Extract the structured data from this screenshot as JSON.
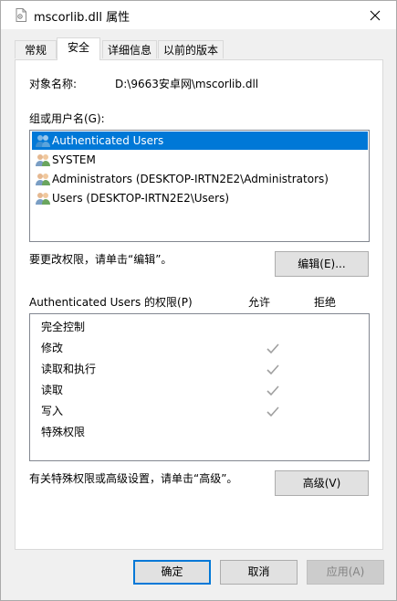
{
  "window": {
    "title": "mscorlib.dll 属性",
    "close_glyph": "✕"
  },
  "tabs": [
    {
      "label": "常规",
      "active": false
    },
    {
      "label": "安全",
      "active": true
    },
    {
      "label": "详细信息",
      "active": false
    },
    {
      "label": "以前的版本",
      "active": false
    }
  ],
  "security": {
    "object_name_label": "对象名称:",
    "object_name_value": "D:\\9663安卓网\\mscorlib.dll",
    "groups_label": "组或用户名(G):",
    "users": [
      {
        "name": "Authenticated Users",
        "selected": true
      },
      {
        "name": "SYSTEM",
        "selected": false
      },
      {
        "name": "Administrators (DESKTOP-IRTN2E2\\Administrators)",
        "selected": false
      },
      {
        "name": "Users (DESKTOP-IRTN2E2\\Users)",
        "selected": false
      }
    ],
    "edit_hint": "要更改权限，请单击“编辑”。",
    "edit_button": "编辑(E)...",
    "permissions_label": "Authenticated Users 的权限(P)",
    "allow_header": "允许",
    "deny_header": "拒绝",
    "permissions": [
      {
        "name": "完全控制",
        "allow": false,
        "deny": false
      },
      {
        "name": "修改",
        "allow": true,
        "deny": false
      },
      {
        "name": "读取和执行",
        "allow": true,
        "deny": false
      },
      {
        "name": "读取",
        "allow": true,
        "deny": false
      },
      {
        "name": "写入",
        "allow": true,
        "deny": false
      },
      {
        "name": "特殊权限",
        "allow": false,
        "deny": false
      }
    ],
    "advanced_hint": "有关特殊权限或高级设置，请单击“高级”。",
    "advanced_button": "高级(V)"
  },
  "footer": {
    "ok": "确定",
    "cancel": "取消",
    "apply": "应用(A)"
  },
  "colors": {
    "selection": "#0078d7",
    "check_gray": "#a0a0a0"
  }
}
